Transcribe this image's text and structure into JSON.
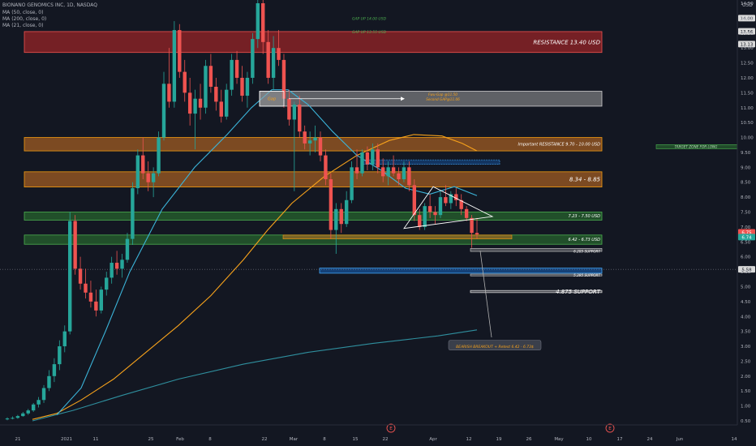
{
  "header": {
    "symbol_line": "BIONANO GENOMICS INC, 1D, NASDAQ",
    "indicators": [
      "MA (50, close, 0)",
      "MA (200, close, 0)",
      "MA (21, close, 0)"
    ],
    "currency": "USD"
  },
  "colors": {
    "background": "#131722",
    "up": "#26a69a",
    "down": "#ef5350",
    "ma50": "#f7a21b",
    "ma200": "#2f8f9e",
    "ma21": "#3bb4d9",
    "red_zone": "#c62828",
    "orange_zone": "#e67e22",
    "green_zone": "#2e7d32",
    "gray_zone": "#9e9e9e",
    "blue_zone": "#1565c0"
  },
  "chart_data": {
    "type": "candlestick",
    "title": "BIONANO GENOMICS INC, 1D, NASDAQ",
    "xlabel": "",
    "ylabel": "USD",
    "ylim": [
      0.5,
      14.5
    ],
    "y_ticks": [
      0.5,
      1.0,
      1.5,
      2.0,
      2.5,
      3.0,
      3.5,
      4.0,
      4.5,
      5.0,
      5.5,
      6.0,
      6.5,
      7.0,
      7.5,
      8.0,
      8.5,
      9.0,
      9.5,
      10.0,
      10.5,
      11.0,
      11.5,
      12.0,
      12.5,
      13.0,
      13.5,
      14.0,
      14.5
    ],
    "x_tick_labels": [
      "21",
      "2021",
      "11",
      "25",
      "Feb",
      "8",
      "22",
      "Mar",
      "8",
      "15",
      "22",
      "Apr",
      "12",
      "19",
      "26",
      "May",
      "10",
      "17",
      "24",
      "Jun",
      "14"
    ],
    "grid": false,
    "candles": [
      {
        "o": 0.55,
        "h": 0.62,
        "l": 0.52,
        "c": 0.58
      },
      {
        "o": 0.58,
        "h": 0.65,
        "l": 0.55,
        "c": 0.6
      },
      {
        "o": 0.6,
        "h": 0.7,
        "l": 0.57,
        "c": 0.66
      },
      {
        "o": 0.66,
        "h": 0.8,
        "l": 0.64,
        "c": 0.75
      },
      {
        "o": 0.75,
        "h": 0.9,
        "l": 0.7,
        "c": 0.85
      },
      {
        "o": 0.85,
        "h": 1.1,
        "l": 0.8,
        "c": 1.05
      },
      {
        "o": 1.05,
        "h": 1.3,
        "l": 0.95,
        "c": 1.2
      },
      {
        "o": 1.2,
        "h": 1.7,
        "l": 1.1,
        "c": 1.6
      },
      {
        "o": 1.6,
        "h": 2.2,
        "l": 1.5,
        "c": 2.0
      },
      {
        "o": 2.0,
        "h": 2.6,
        "l": 1.8,
        "c": 2.4
      },
      {
        "o": 2.4,
        "h": 3.2,
        "l": 2.2,
        "c": 3.0
      },
      {
        "o": 3.0,
        "h": 3.7,
        "l": 2.8,
        "c": 3.5
      },
      {
        "o": 3.5,
        "h": 7.5,
        "l": 3.4,
        "c": 7.2
      },
      {
        "o": 7.2,
        "h": 7.4,
        "l": 5.4,
        "c": 5.6
      },
      {
        "o": 5.6,
        "h": 6.0,
        "l": 4.9,
        "c": 5.1
      },
      {
        "o": 5.1,
        "h": 5.6,
        "l": 4.6,
        "c": 4.8
      },
      {
        "o": 4.8,
        "h": 5.2,
        "l": 4.3,
        "c": 4.5
      },
      {
        "o": 4.5,
        "h": 4.9,
        "l": 4.0,
        "c": 4.2
      },
      {
        "o": 4.2,
        "h": 5.0,
        "l": 4.1,
        "c": 4.9
      },
      {
        "o": 4.9,
        "h": 5.5,
        "l": 4.7,
        "c": 5.3
      },
      {
        "o": 5.3,
        "h": 6.0,
        "l": 5.1,
        "c": 5.8
      },
      {
        "o": 5.8,
        "h": 6.2,
        "l": 5.4,
        "c": 5.6
      },
      {
        "o": 5.6,
        "h": 6.1,
        "l": 5.3,
        "c": 5.9
      },
      {
        "o": 5.9,
        "h": 6.8,
        "l": 5.8,
        "c": 6.6
      },
      {
        "o": 6.6,
        "h": 8.5,
        "l": 6.4,
        "c": 8.3
      },
      {
        "o": 8.3,
        "h": 9.6,
        "l": 8.1,
        "c": 9.4
      },
      {
        "o": 9.4,
        "h": 10.0,
        "l": 8.6,
        "c": 8.8
      },
      {
        "o": 8.8,
        "h": 9.2,
        "l": 8.2,
        "c": 8.5
      },
      {
        "o": 8.5,
        "h": 9.0,
        "l": 8.0,
        "c": 8.8
      },
      {
        "o": 8.8,
        "h": 10.2,
        "l": 8.7,
        "c": 10.0
      },
      {
        "o": 10.0,
        "h": 12.2,
        "l": 9.9,
        "c": 11.8
      },
      {
        "o": 11.8,
        "h": 13.0,
        "l": 11.0,
        "c": 11.2
      },
      {
        "o": 11.2,
        "h": 13.9,
        "l": 11.0,
        "c": 13.6
      },
      {
        "o": 13.6,
        "h": 13.8,
        "l": 12.0,
        "c": 12.2
      },
      {
        "o": 12.2,
        "h": 12.6,
        "l": 11.2,
        "c": 11.5
      },
      {
        "o": 11.5,
        "h": 12.0,
        "l": 10.4,
        "c": 10.8
      },
      {
        "o": 10.8,
        "h": 11.6,
        "l": 9.6,
        "c": 11.3
      },
      {
        "o": 11.3,
        "h": 11.8,
        "l": 10.6,
        "c": 11.0
      },
      {
        "o": 11.0,
        "h": 12.6,
        "l": 10.8,
        "c": 12.4
      },
      {
        "o": 12.4,
        "h": 12.8,
        "l": 11.5,
        "c": 11.7
      },
      {
        "o": 11.7,
        "h": 12.0,
        "l": 10.9,
        "c": 11.2
      },
      {
        "o": 11.2,
        "h": 11.6,
        "l": 10.5,
        "c": 10.7
      },
      {
        "o": 10.7,
        "h": 11.8,
        "l": 10.6,
        "c": 11.6
      },
      {
        "o": 11.6,
        "h": 12.8,
        "l": 11.4,
        "c": 12.6
      },
      {
        "o": 12.6,
        "h": 12.9,
        "l": 11.8,
        "c": 12.0
      },
      {
        "o": 12.0,
        "h": 12.4,
        "l": 11.2,
        "c": 11.4
      },
      {
        "o": 11.4,
        "h": 12.2,
        "l": 11.0,
        "c": 12.0
      },
      {
        "o": 12.0,
        "h": 13.5,
        "l": 11.8,
        "c": 13.3
      },
      {
        "o": 13.3,
        "h": 15.0,
        "l": 13.0,
        "c": 14.5
      },
      {
        "o": 14.5,
        "h": 15.0,
        "l": 12.8,
        "c": 13.2
      },
      {
        "o": 13.2,
        "h": 13.6,
        "l": 11.8,
        "c": 12.0
      },
      {
        "o": 12.0,
        "h": 13.4,
        "l": 11.6,
        "c": 13.0
      },
      {
        "o": 13.0,
        "h": 13.6,
        "l": 12.4,
        "c": 12.6
      },
      {
        "o": 12.6,
        "h": 12.8,
        "l": 11.0,
        "c": 11.3
      },
      {
        "o": 11.3,
        "h": 11.6,
        "l": 10.4,
        "c": 10.6
      },
      {
        "o": 10.6,
        "h": 11.2,
        "l": 8.2,
        "c": 11.1
      },
      {
        "o": 11.1,
        "h": 11.4,
        "l": 10.0,
        "c": 10.2
      },
      {
        "o": 10.2,
        "h": 10.4,
        "l": 9.6,
        "c": 9.8
      },
      {
        "o": 9.8,
        "h": 10.2,
        "l": 9.4,
        "c": 9.9
      },
      {
        "o": 9.9,
        "h": 10.4,
        "l": 9.5,
        "c": 10.0
      },
      {
        "o": 10.0,
        "h": 10.2,
        "l": 9.2,
        "c": 9.4
      },
      {
        "o": 9.4,
        "h": 9.6,
        "l": 8.4,
        "c": 8.6
      },
      {
        "o": 8.6,
        "h": 8.8,
        "l": 6.6,
        "c": 6.9
      },
      {
        "o": 6.9,
        "h": 7.8,
        "l": 6.1,
        "c": 7.6
      },
      {
        "o": 7.6,
        "h": 7.8,
        "l": 6.8,
        "c": 7.1
      },
      {
        "o": 7.1,
        "h": 8.2,
        "l": 7.0,
        "c": 7.9
      },
      {
        "o": 7.9,
        "h": 9.2,
        "l": 7.8,
        "c": 9.0
      },
      {
        "o": 9.0,
        "h": 9.6,
        "l": 8.6,
        "c": 8.8
      },
      {
        "o": 8.8,
        "h": 9.6,
        "l": 8.7,
        "c": 9.5
      },
      {
        "o": 9.5,
        "h": 9.7,
        "l": 8.9,
        "c": 9.1
      },
      {
        "o": 9.1,
        "h": 9.8,
        "l": 8.9,
        "c": 9.6
      },
      {
        "o": 9.6,
        "h": 9.8,
        "l": 8.8,
        "c": 9.0
      },
      {
        "o": 9.0,
        "h": 9.3,
        "l": 8.5,
        "c": 8.7
      },
      {
        "o": 8.7,
        "h": 9.2,
        "l": 8.4,
        "c": 9.0
      },
      {
        "o": 9.0,
        "h": 9.4,
        "l": 8.7,
        "c": 8.8
      },
      {
        "o": 8.8,
        "h": 9.0,
        "l": 8.4,
        "c": 8.6
      },
      {
        "o": 8.6,
        "h": 9.2,
        "l": 8.5,
        "c": 9.0
      },
      {
        "o": 9.0,
        "h": 9.2,
        "l": 8.2,
        "c": 8.4
      },
      {
        "o": 8.4,
        "h": 8.6,
        "l": 7.2,
        "c": 7.4
      },
      {
        "o": 7.4,
        "h": 7.6,
        "l": 6.9,
        "c": 7.0
      },
      {
        "o": 7.0,
        "h": 7.8,
        "l": 6.9,
        "c": 7.7
      },
      {
        "o": 7.7,
        "h": 8.1,
        "l": 7.3,
        "c": 7.5
      },
      {
        "o": 7.5,
        "h": 7.7,
        "l": 7.1,
        "c": 7.4
      },
      {
        "o": 7.4,
        "h": 8.2,
        "l": 7.3,
        "c": 8.0
      },
      {
        "o": 8.0,
        "h": 8.4,
        "l": 7.7,
        "c": 7.8
      },
      {
        "o": 7.8,
        "h": 8.2,
        "l": 7.6,
        "c": 8.1
      },
      {
        "o": 8.1,
        "h": 8.3,
        "l": 7.7,
        "c": 7.9
      },
      {
        "o": 7.9,
        "h": 8.1,
        "l": 7.4,
        "c": 7.6
      },
      {
        "o": 7.6,
        "h": 7.7,
        "l": 7.2,
        "c": 7.3
      },
      {
        "o": 7.3,
        "h": 7.4,
        "l": 6.3,
        "c": 6.8
      },
      {
        "o": 6.8,
        "h": 7.3,
        "l": 6.6,
        "c": 6.75
      }
    ],
    "moving_averages": [
      {
        "name": "MA (50, close, 0)",
        "values_at": "approximate curve",
        "color": "#f7a21b"
      },
      {
        "name": "MA (200, close, 0)",
        "color": "#2f8f9e"
      },
      {
        "name": "MA (21, close, 0)",
        "color": "#3bb4d9"
      }
    ],
    "zones": [
      {
        "kind": "red",
        "y1": 12.85,
        "y2": 13.55,
        "label": "RESISTANCE 13.40 USD"
      },
      {
        "kind": "gray",
        "y1": 11.05,
        "y2": 11.55,
        "label": ""
      },
      {
        "kind": "orange",
        "y1": 9.55,
        "y2": 10.0,
        "label": "Important RESISTANCE 9.70 - 10.00 USD"
      },
      {
        "kind": "orange",
        "y1": 8.34,
        "y2": 8.85,
        "label": "8.34 - 8.85"
      },
      {
        "kind": "green",
        "y1": 7.23,
        "y2": 7.5,
        "label": "7.23 - 7.50 USD"
      },
      {
        "kind": "green",
        "y1": 6.42,
        "y2": 6.73,
        "label": "6.42 - 6.73 USD"
      },
      {
        "kind": "blue",
        "y1": 5.45,
        "y2": 5.62,
        "label": ""
      },
      {
        "kind": "gray",
        "y1": 4.8,
        "y2": 4.87,
        "label": "4.875 SUPPORT"
      }
    ],
    "annotations": [
      {
        "text": "GAP UP 14.00 USD",
        "value": 14.0
      },
      {
        "text": "GAP UP 13.55 USD",
        "value": 13.55
      },
      {
        "text": "Gap",
        "value": 11.3
      },
      {
        "text": "Fwu-Gap @11.50",
        "value": 11.45
      },
      {
        "text": "Second GAP@11.06",
        "value": 11.3
      },
      {
        "text": "TARGET ZONE FOR LONG",
        "value": 9.7
      },
      {
        "text": "6.205 SUPPORT",
        "value": 6.2
      },
      {
        "text": "5.395 SUPPORT",
        "value": 5.4
      },
      {
        "text": "BEARISH BREAKOUT + Retest 6.42 - 6.73$",
        "value": 3.0
      }
    ],
    "price_tags": [
      {
        "text": "14.00",
        "value": 14.0,
        "color": "#d9d9d9"
      },
      {
        "text": "13.56",
        "value": 13.56,
        "color": "#d9d9d9"
      },
      {
        "text": "13.13",
        "value": 13.13,
        "color": "#d9d9d9"
      },
      {
        "text": "6.75",
        "value": 6.82,
        "color": "#ef5350"
      },
      {
        "text": "6.74",
        "value": 6.66,
        "color": "#26a69a"
      },
      {
        "text": "5.58",
        "value": 5.58,
        "color": "#d9d9d9"
      }
    ],
    "event_markers": [
      "E",
      "E"
    ]
  }
}
